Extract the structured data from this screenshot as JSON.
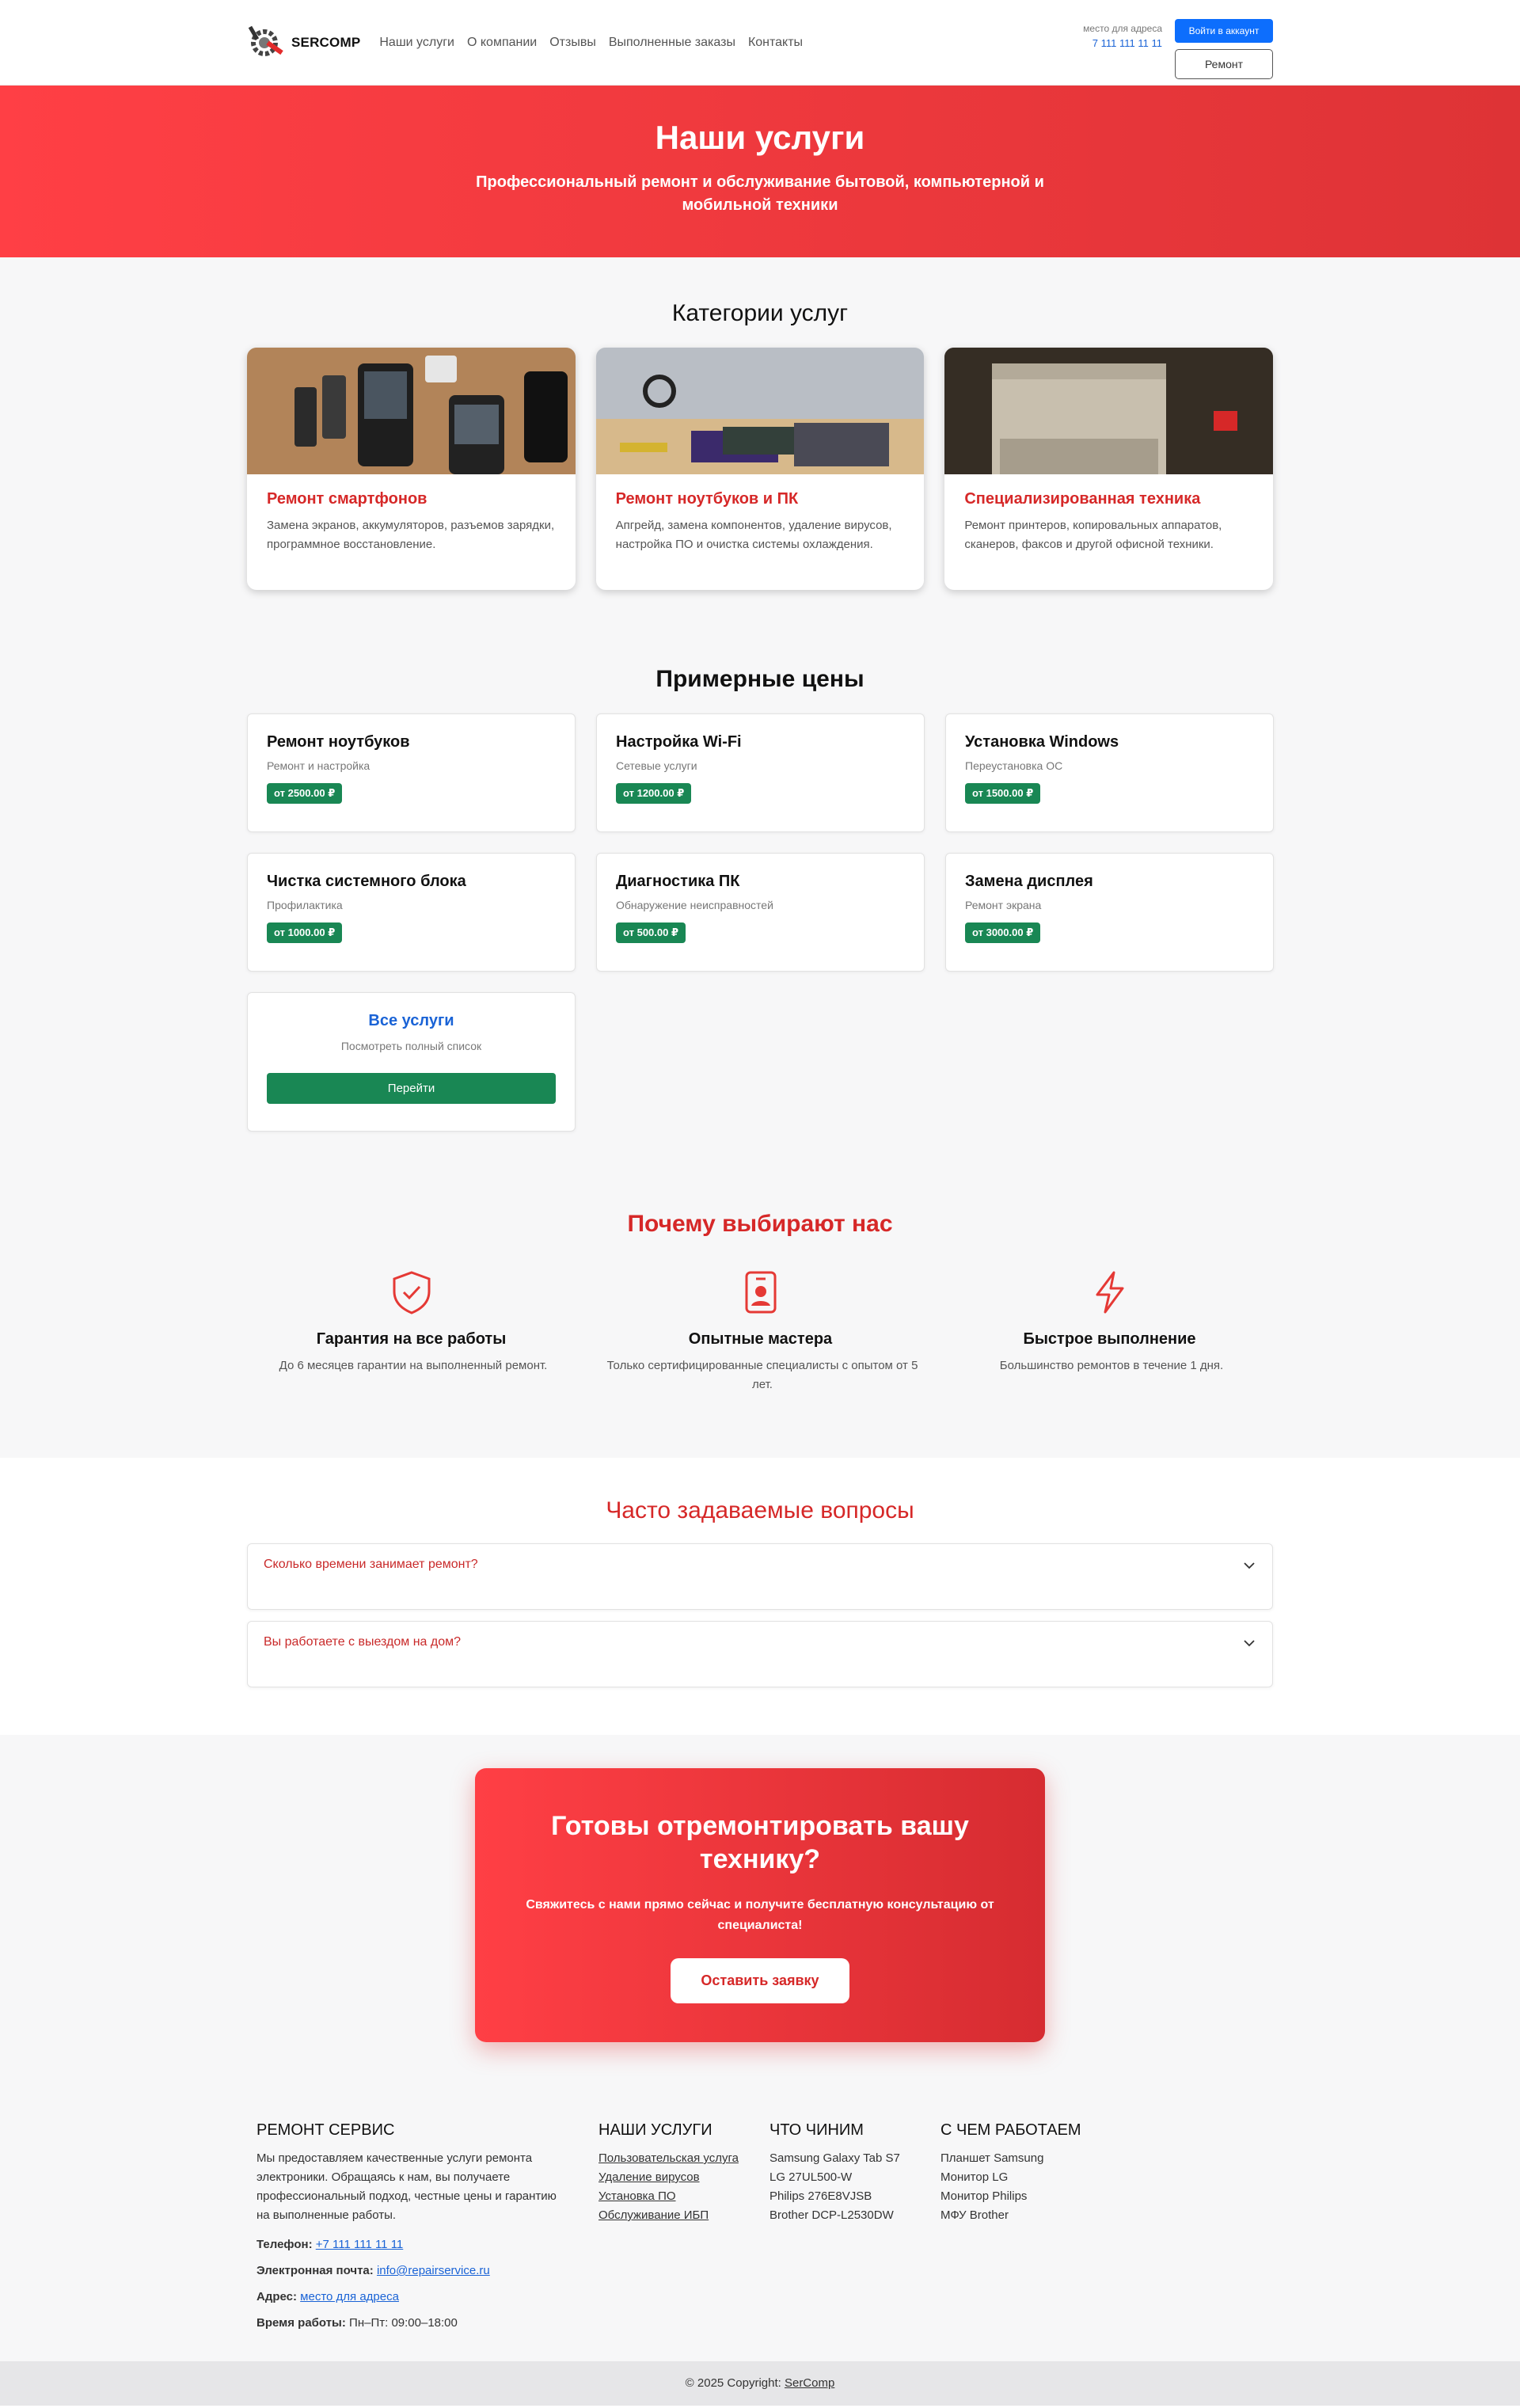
{
  "header": {
    "logo_text": "SERCOMP",
    "nav": [
      "Наши услуги",
      "О компании",
      "Отзывы",
      "Выполненные заказы",
      "Контакты"
    ],
    "address": "место для адреса",
    "phone": "7 111 111 11 11",
    "login_label": "Войти в аккаунт",
    "repair_label": "Ремонт"
  },
  "hero": {
    "title": "Наши услуги",
    "subtitle": "Профессиональный ремонт и обслуживание бытовой, компьютерной и мобильной техники"
  },
  "categories": {
    "title": "Категории услуг",
    "items": [
      {
        "title": "Ремонт смартфонов",
        "desc": "Замена экранов, аккумуляторов, разъемов зарядки, программное восстановление."
      },
      {
        "title": "Ремонт ноутбуков и ПК",
        "desc": "Апгрейд, замена компонентов, удаление вирусов, настройка ПО и очистка системы охлаждения."
      },
      {
        "title": "Специализированная техника",
        "desc": "Ремонт принтеров, копировальных аппаратов, сканеров, факсов и другой офисной техники."
      }
    ]
  },
  "prices": {
    "title": "Примерные цены",
    "items": [
      {
        "title": "Ремонт ноутбуков",
        "sub": "Ремонт и настройка",
        "price": "от 2500.00 ₽"
      },
      {
        "title": "Настройка Wi-Fi",
        "sub": "Сетевые услуги",
        "price": "от 1200.00 ₽"
      },
      {
        "title": "Установка Windows",
        "sub": "Переустановка ОС",
        "price": "от 1500.00 ₽"
      },
      {
        "title": "Чистка системного блока",
        "sub": "Профилактика",
        "price": "от 1000.00 ₽"
      },
      {
        "title": "Диагностика ПК",
        "sub": "Обнаружение неисправностей",
        "price": "от 500.00 ₽"
      },
      {
        "title": "Замена дисплея",
        "sub": "Ремонт экрана",
        "price": "от 3000.00 ₽"
      }
    ],
    "all": {
      "title": "Все услуги",
      "sub": "Посмотреть полный список",
      "button": "Перейти"
    }
  },
  "why": {
    "title": "Почему выбирают нас",
    "items": [
      {
        "icon": "shield-check-icon",
        "title": "Гарантия на все работы",
        "desc": "До 6 месяцев гарантии на выполненный ремонт."
      },
      {
        "icon": "badge-person-icon",
        "title": "Опытные мастера",
        "desc": "Только сертифицированные специалисты с опытом от 5 лет."
      },
      {
        "icon": "lightning-icon",
        "title": "Быстрое выполнение",
        "desc": "Большинство ремонтов в течение 1 дня."
      }
    ]
  },
  "faq": {
    "title": "Часто задаваемые вопросы",
    "items": [
      "Сколько времени занимает ремонт?",
      "Вы работаете с выездом на дом?"
    ]
  },
  "cta": {
    "title": "Готовы отремонтировать вашу технику?",
    "text": "Свяжитесь с нами прямо сейчас и получите бесплатную консультацию от специалиста!",
    "button": "Оставить заявку"
  },
  "footer": {
    "about_title": "РЕМОНТ СЕРВИС",
    "about_text": "Мы предоставляем качественные услуги ремонта электроники. Обращаясь к нам, вы получаете профессиональный подход, честные цены и гарантию на выполненные работы.",
    "phone_label": "Телефон:",
    "phone": "+7 111 111 11 11",
    "email_label": "Электронная почта:",
    "email": "info@repairservice.ru",
    "address_label": "Адрес:",
    "address": "место для адреса",
    "hours_label": "Время работы:",
    "hours": "Пн–Пт: 09:00–18:00",
    "services_title": "НАШИ УСЛУГИ",
    "services": [
      "Пользовательская услуга",
      "Удаление вирусов",
      "Установка ПО",
      "Обслуживание ИБП"
    ],
    "fix_title": "ЧТО ЧИНИМ",
    "fix": [
      "Samsung Galaxy Tab S7",
      "LG 27UL500-W",
      "Philips 276E8VJSB",
      "Brother DCP-L2530DW"
    ],
    "work_title": "С ЧЕМ РАБОТАЕМ",
    "work": [
      "Планшет Samsung",
      "Монитор LG",
      "Монитор Philips",
      "МФУ Brother"
    ],
    "copyright_prefix": "© 2025 Copyright:",
    "copyright_link": "SerComp"
  },
  "colors": {
    "accent": "#e53935",
    "green": "#198754",
    "blue": "#0d6efd"
  }
}
